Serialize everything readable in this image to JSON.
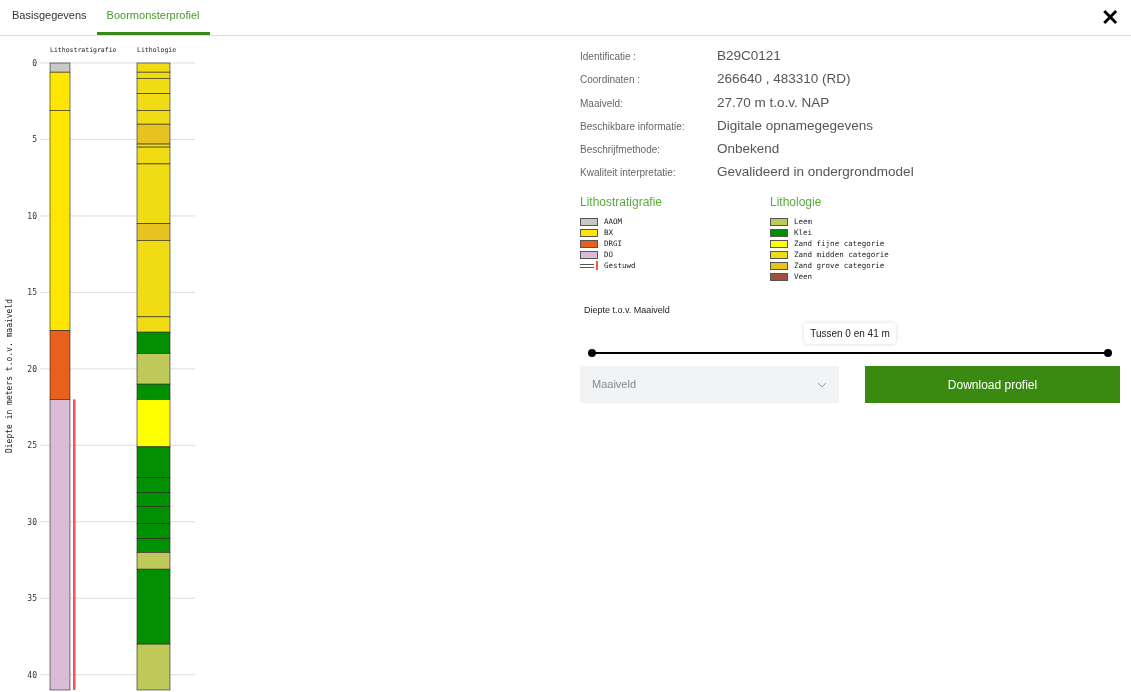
{
  "tabs": [
    {
      "label": "Basisgegevens",
      "selected": false
    },
    {
      "label": "Boormonsterprofiel",
      "selected": true
    }
  ],
  "close": {
    "glyph": "✕"
  },
  "profile": {
    "chart_data": {
      "type": "bar",
      "stacked": true,
      "orientation": "vertical",
      "ylabel": "Diepte in meters t.o.v. maaiveld",
      "categories": [
        "Lithostratigrafie",
        "Lithologie"
      ],
      "ylim": [
        41,
        0
      ],
      "yticks": [
        0,
        5,
        10,
        15,
        20,
        25,
        30,
        35,
        40
      ],
      "grid": true,
      "series": [
        {
          "color": "#c8c8c8",
          "values": [
            0.6,
            null
          ]
        },
        {
          "color": "#ffe600",
          "values": [
            2.5,
            null
          ]
        },
        {
          "color": "#ffe600",
          "values": [
            14.4,
            null
          ]
        },
        {
          "color": "#e8601c",
          "values": [
            4.5,
            null
          ]
        },
        {
          "color": "#d8bcd8",
          "values": [
            19,
            null
          ]
        },
        {
          "color": "#f0dc14",
          "values": [
            null,
            0.6
          ]
        },
        {
          "color": "#f0dc14",
          "values": [
            null,
            0.4
          ]
        },
        {
          "color": "#f0dc14",
          "values": [
            null,
            1.0
          ]
        },
        {
          "color": "#f0dc14",
          "values": [
            null,
            1.1
          ]
        },
        {
          "color": "#f0dc14",
          "values": [
            null,
            0.9
          ]
        },
        {
          "color": "#e6c31e",
          "values": [
            null,
            1.3
          ]
        },
        {
          "color": "#f0dc14",
          "values": [
            null,
            0.2
          ]
        },
        {
          "color": "#f0dc14",
          "values": [
            null,
            1.1
          ]
        },
        {
          "color": "#f0dc14",
          "values": [
            null,
            3.9
          ]
        },
        {
          "color": "#e6c31e",
          "values": [
            null,
            1.1
          ]
        },
        {
          "color": "#f0dc14",
          "values": [
            null,
            5.0
          ]
        },
        {
          "color": "#f0dc14",
          "values": [
            null,
            1.0
          ]
        },
        {
          "color": "#009000",
          "values": [
            null,
            1.4
          ]
        },
        {
          "color": "#bfc95a",
          "values": [
            null,
            2.0
          ]
        },
        {
          "color": "#009000",
          "values": [
            null,
            1.0
          ]
        },
        {
          "color": "#ffff00",
          "values": [
            null,
            3.1
          ]
        },
        {
          "color": "#009000",
          "values": [
            null,
            2.0
          ]
        },
        {
          "color": "#009000",
          "values": [
            null,
            1.0
          ]
        },
        {
          "color": "#009000",
          "values": [
            null,
            0.9
          ]
        },
        {
          "color": "#009000",
          "values": [
            null,
            1.1
          ]
        },
        {
          "color": "#009000",
          "values": [
            null,
            1.0
          ]
        },
        {
          "color": "#009000",
          "values": [
            null,
            0.9
          ]
        },
        {
          "color": "#bfc95a",
          "values": [
            null,
            1.1
          ]
        },
        {
          "color": "#009000",
          "values": [
            null,
            4.9
          ]
        },
        {
          "color": "#bfc95a",
          "values": [
            null,
            3.0
          ]
        }
      ]
    }
  },
  "details": [
    {
      "label": "Identificatie :",
      "value": "B29C0121"
    },
    {
      "label": "Coordinaten :",
      "value": "266640 , 483310 (RD)"
    },
    {
      "label": "Maaiveld:",
      "value": "27.70 m t.o.v. NAP"
    },
    {
      "label": "Beschikbare informatie:",
      "value": "Digitale opnamegegevens"
    },
    {
      "label": "Beschrijfmethode:",
      "value": "Onbekend"
    },
    {
      "label": "Kwaliteit interpretatie:",
      "value": "Gevalideerd in ondergrondmodel"
    }
  ],
  "legends": [
    {
      "title": "Lithostratigrafie",
      "items": [
        {
          "kind": "swatch",
          "label": "AAOM",
          "color": "#c8c8c8"
        },
        {
          "kind": "swatch",
          "label": "BX",
          "color": "#ffe600"
        },
        {
          "kind": "swatch",
          "label": "DRGI",
          "color": "#e8601c"
        },
        {
          "kind": "swatch",
          "label": "DO",
          "color": "#d8bcd8"
        },
        {
          "kind": "line",
          "label": "Gestuwd",
          "color": "#ff5050"
        }
      ]
    },
    {
      "title": "Lithologie",
      "items": [
        {
          "kind": "swatch",
          "label": "Leem",
          "color": "#bfc95a"
        },
        {
          "kind": "swatch",
          "label": "Klei",
          "color": "#009000"
        },
        {
          "kind": "swatch",
          "label": "Zand fijne categorie",
          "color": "#ffff00"
        },
        {
          "kind": "swatch",
          "label": "Zand midden categorie",
          "color": "#f0dc14"
        },
        {
          "kind": "swatch",
          "label": "Zand grove categorie",
          "color": "#e6c31e"
        },
        {
          "kind": "swatch",
          "label": "Veen",
          "color": "#a0503c"
        }
      ]
    }
  ],
  "depth_slider": {
    "label": "Diepte t.o.v. Maaiveld",
    "tooltip": "Tussen 0 en 41 m",
    "thumbs": [
      {
        "level": 0
      },
      {
        "level": 1
      }
    ]
  },
  "reference_select": {
    "value": "Maaiveld"
  },
  "download_button": {
    "label": "Download profiel"
  }
}
